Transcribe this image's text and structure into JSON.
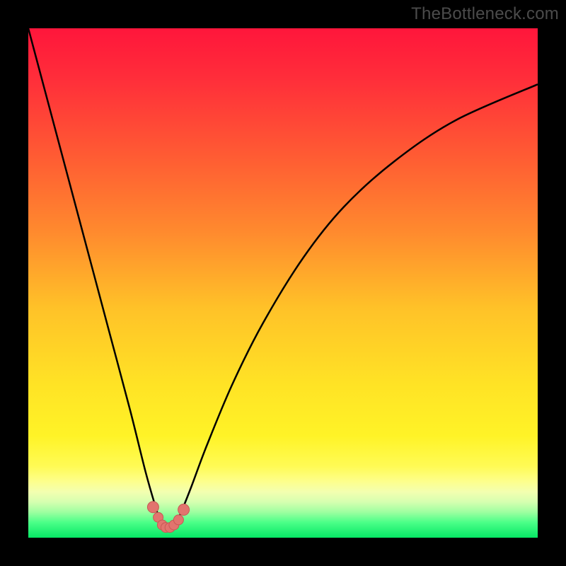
{
  "watermark": "TheBottleneck.com",
  "colors": {
    "frame": "#000000",
    "curve": "#000000",
    "marker_fill": "#e2746e",
    "marker_stroke": "#c65a55",
    "gradient_stops": [
      {
        "offset": 0.0,
        "color": "#ff163b"
      },
      {
        "offset": 0.1,
        "color": "#ff2e3a"
      },
      {
        "offset": 0.25,
        "color": "#ff5b33"
      },
      {
        "offset": 0.4,
        "color": "#ff8a2e"
      },
      {
        "offset": 0.55,
        "color": "#ffc228"
      },
      {
        "offset": 0.7,
        "color": "#ffe325"
      },
      {
        "offset": 0.8,
        "color": "#fff327"
      },
      {
        "offset": 0.86,
        "color": "#fffb55"
      },
      {
        "offset": 0.89,
        "color": "#fdff8d"
      },
      {
        "offset": 0.91,
        "color": "#f3ffb0"
      },
      {
        "offset": 0.93,
        "color": "#d6ffb0"
      },
      {
        "offset": 0.95,
        "color": "#9dffa0"
      },
      {
        "offset": 0.97,
        "color": "#4bff88"
      },
      {
        "offset": 1.0,
        "color": "#06e765"
      }
    ]
  },
  "chart_data": {
    "type": "line",
    "title": "",
    "xlabel": "",
    "ylabel": "",
    "xlim": [
      0,
      100
    ],
    "ylim": [
      0,
      100
    ],
    "grid": false,
    "legend": false,
    "note": "V-shaped bottleneck curve; minimum around x≈27, y≈2. Axis units are percent of plot area (no numeric ticks are rendered in the source image).",
    "series": [
      {
        "name": "bottleneck_curve",
        "x": [
          0,
          4,
          8,
          12,
          16,
          20,
          23,
          25,
          26,
          27,
          28,
          29,
          30,
          32,
          35,
          40,
          46,
          54,
          62,
          72,
          84,
          100
        ],
        "y": [
          100,
          85,
          70,
          55,
          40,
          25,
          13,
          6,
          3,
          2,
          2,
          3,
          5,
          10,
          18,
          30,
          42,
          55,
          65,
          74,
          82,
          89
        ]
      }
    ],
    "markers": {
      "name": "highlight_points",
      "x": [
        24.5,
        25.5,
        26.3,
        27.0,
        27.8,
        28.6,
        29.5,
        30.5
      ],
      "y": [
        6.0,
        4.0,
        2.5,
        2.0,
        2.0,
        2.5,
        3.5,
        5.5
      ]
    }
  }
}
